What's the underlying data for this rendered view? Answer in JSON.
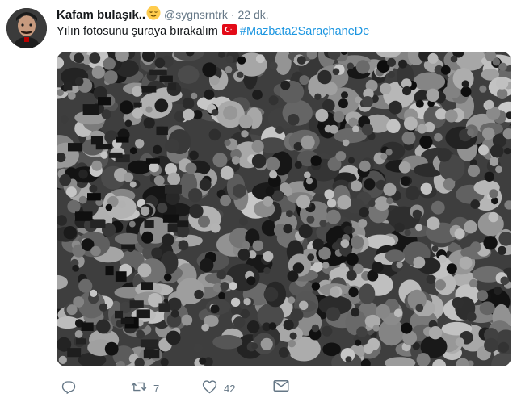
{
  "tweet": {
    "display_name": "Kafam bulaşık..",
    "handle": "@sygnsrntrk",
    "separator": "·",
    "time": "22 dk.",
    "text": "Yılın fotosunu şuraya bırakalım",
    "hashtag": "#Mazbata2SaraçhaneDe"
  },
  "actions": {
    "reply_count": "",
    "retweet_count": "7",
    "like_count": "42"
  },
  "icons": {
    "reply": "reply-icon",
    "retweet": "retweet-icon",
    "like": "heart-icon",
    "dm": "envelope-icon",
    "emoji": "relieved-face-emoji",
    "flag": "turkey-flag-emoji"
  },
  "colors": {
    "text": "#14171a",
    "secondary": "#657786",
    "hashtag": "#1b95e0",
    "flag": "#e30a17"
  }
}
